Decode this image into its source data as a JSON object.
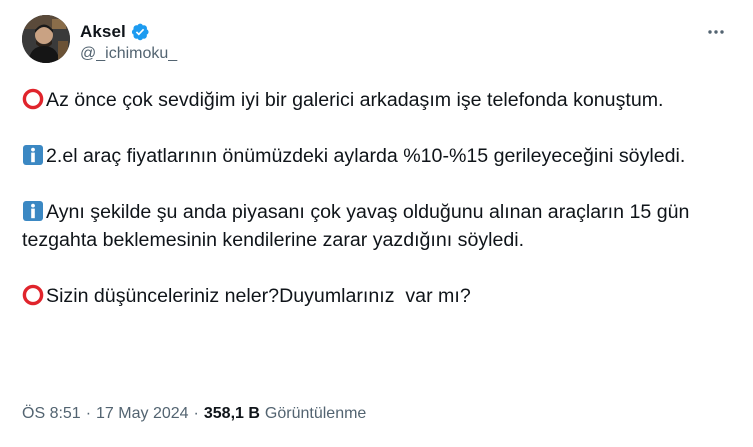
{
  "author": {
    "display_name": "Aksel",
    "handle": "@_ichimoku_",
    "verified_color": "#1d9bf0"
  },
  "icons": {
    "verified": "verified-badge-icon",
    "more": "more-options-icon",
    "circle": "hollow-red-circle-emoji",
    "info": "information-emoji"
  },
  "colors": {
    "text": "#0f1419",
    "secondary": "#536471",
    "circle_red": "#e0242c",
    "info_blue": "#3b88c3"
  },
  "tweet": {
    "paragraphs": [
      {
        "emoji": "circle",
        "text": "Az önce çok sevdiğim iyi bir galerici arkadaşım işe telefonda konuştum."
      },
      {
        "emoji": "info",
        "text": "2.el araç fiyatlarının önümüzdeki aylarda %10-%15 gerileyeceğini söyledi."
      },
      {
        "emoji": "info",
        "text": "Aynı şekilde şu anda piyasanı çok yavaş olduğunu alınan araçların 15 gün tezgahta beklemesinin kendilerine zarar yazdığını söyledi."
      },
      {
        "emoji": "circle",
        "text": "Sizin düşünceleriniz neler?Duyumlarınız  var mı?"
      }
    ]
  },
  "meta": {
    "time": "ÖS 8:51",
    "separator": "·",
    "date": "17 May 2024",
    "views_count": "358,1 B",
    "views_label": "Görüntülenme"
  }
}
